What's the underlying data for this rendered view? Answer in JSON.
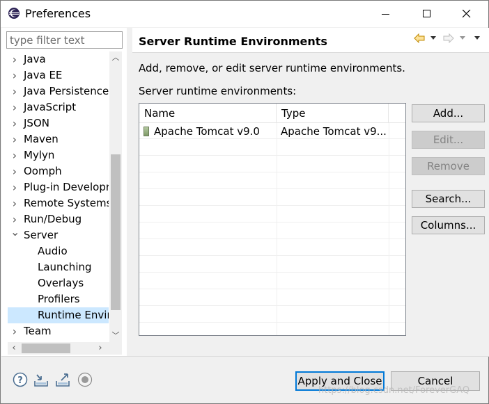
{
  "window": {
    "title": "Preferences",
    "minimize": "—",
    "maximize": "☐",
    "close": "✕"
  },
  "filter": {
    "placeholder": "type filter text",
    "value": ""
  },
  "tree": {
    "items": [
      {
        "label": "Java",
        "expanded": false
      },
      {
        "label": "Java EE",
        "expanded": false
      },
      {
        "label": "Java Persistence",
        "expanded": false
      },
      {
        "label": "JavaScript",
        "expanded": false
      },
      {
        "label": "JSON",
        "expanded": false
      },
      {
        "label": "Maven",
        "expanded": false
      },
      {
        "label": "Mylyn",
        "expanded": false
      },
      {
        "label": "Oomph",
        "expanded": false
      },
      {
        "label": "Plug-in Developr",
        "expanded": false
      },
      {
        "label": "Remote Systems",
        "expanded": false
      },
      {
        "label": "Run/Debug",
        "expanded": false
      },
      {
        "label": "Server",
        "expanded": true
      },
      {
        "label": "Audio",
        "child": true
      },
      {
        "label": "Launching",
        "child": true
      },
      {
        "label": "Overlays",
        "child": true
      },
      {
        "label": "Profilers",
        "child": true
      },
      {
        "label": "Runtime Envir",
        "child": true,
        "selected": true
      },
      {
        "label": "Team",
        "expanded": false
      }
    ]
  },
  "page": {
    "title": "Server Runtime Environments",
    "description": "Add, remove, or edit server runtime environments.",
    "list_label": "Server runtime environments:"
  },
  "table": {
    "columns": [
      "Name",
      "Type"
    ],
    "rows": [
      {
        "name": "Apache Tomcat v9.0",
        "type": "Apache Tomcat v9..."
      }
    ]
  },
  "buttons": {
    "add": "Add...",
    "edit": "Edit...",
    "remove": "Remove",
    "search": "Search...",
    "columns": "Columns..."
  },
  "footer": {
    "apply_close": "Apply and Close",
    "cancel": "Cancel",
    "watermark": "https://blog.csdn.net/ForeverGAQ"
  },
  "colors": {
    "selection": "#cce8ff",
    "focus_border": "#0078d7",
    "nav_back": "#d49a00"
  }
}
